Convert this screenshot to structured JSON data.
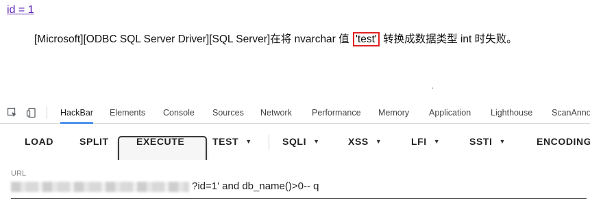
{
  "page": {
    "link_text": "id = 1",
    "error_prefix": "[Microsoft][ODBC SQL Server Driver][SQL Server]在将 nvarchar 值 ",
    "error_highlight": "'test'",
    "error_suffix": " 转换成数据类型 int 时失败。",
    "highlight_color": "#e02020"
  },
  "devtools": {
    "icons": [
      "inspect-element-icon",
      "device-toolbar-icon"
    ],
    "tabs": [
      "HackBar",
      "Elements",
      "Console",
      "Sources",
      "Network",
      "Performance",
      "Memory",
      "Application",
      "Lighthouse",
      "ScanAnno"
    ],
    "active_tab": "HackBar",
    "accent": "#1a73e8"
  },
  "hackbar": {
    "buttons": [
      "LOAD",
      "SPLIT",
      "EXECUTE",
      "TEST",
      "SQLI",
      "XSS",
      "LFI",
      "SSTI",
      "ENCODING"
    ],
    "dropdown_buttons": [
      "TEST",
      "SQLI",
      "XSS",
      "LFI",
      "SSTI"
    ],
    "highlighted_button": "EXECUTE",
    "url_label": "URL",
    "url_visible_text": "?id=1' and db_name()>0-- q"
  }
}
